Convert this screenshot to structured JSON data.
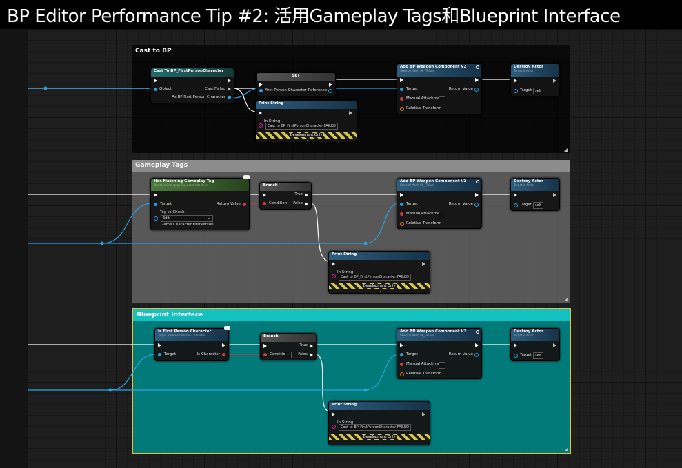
{
  "title": "BP Editor Performance Tip #2: 活用Gameplay Tags和Blueprint Interface",
  "colors": {
    "wire_blue": "#29a3e0",
    "wire_exec": "#ffffff",
    "comment_cyan": "#13c1c1",
    "comment_selected_border": "#e6c038"
  },
  "comments": [
    {
      "title": "Cast to BP"
    },
    {
      "title": "Gameplay Tags"
    },
    {
      "title": "Blueprint Interface"
    }
  ],
  "cast_section": {
    "cast_node": {
      "title": "Cast To BP_FirstPersonCharacter",
      "object": "Object",
      "cast_failed": "Cast Failed",
      "as": "As BP First Person Character"
    },
    "set_node": {
      "title": "SET",
      "pin": "First Person Character Reference"
    },
    "print_node": {
      "title": "Print String",
      "in_string": "In String",
      "value": "Cast to BP_FirstPersonCharacter FAILED",
      "dev": "Development Only"
    },
    "add_node": {
      "title": "Add BP Weapon Component V2",
      "subtitle": "Skeletal Mesh SK_FPGun",
      "target": "Target",
      "return_value": "Return Value",
      "manual": "Manual Attachment",
      "relative": "Relative Transform"
    },
    "destroy_node": {
      "title": "Destroy Actor",
      "subtitle": "Target is Actor",
      "target": "Target",
      "self": "self"
    }
  },
  "tags_section": {
    "has_tag_node": {
      "title": "Has Matching Gameplay Tag",
      "subtitle": "Target is Gameplay Tag Asset Interface",
      "target": "Target",
      "return_value": "Return Value",
      "tag_to_check": "Tag to Check",
      "edit": "Edit",
      "tag": "Game.Character.FirstPerson"
    },
    "branch_node": {
      "title": "Branch",
      "true": "True",
      "condition": "Condition",
      "false": "False"
    },
    "print_node": {
      "title": "Print String",
      "in_string": "In String",
      "value": "Cast to BP_FirstPersonCharacter FAILED",
      "dev": "Development Only"
    },
    "add_node": {
      "title": "Add BP Weapon Component V2",
      "subtitle": "Skeletal Mesh SK_FPGun",
      "target": "Target",
      "return_value": "Return Value",
      "manual": "Manual Attachment",
      "relative": "Relative Transform"
    },
    "destroy_node": {
      "title": "Destroy Actor",
      "subtitle": "Target is Actor",
      "target": "Target",
      "self": "self"
    }
  },
  "interface_section": {
    "is_fp_node": {
      "title": "Is First Person Character",
      "subtitle": "Target is BP First Person Character",
      "target": "Target",
      "is_character": "Is Character"
    },
    "branch_node": {
      "title": "Branch",
      "true": "True",
      "condition": "Condition",
      "false": "False"
    },
    "print_node": {
      "title": "Print String",
      "in_string": "In String",
      "value": "Cast to BP_FirstPersonCharacter FAILED",
      "dev": "Development Only"
    },
    "add_node": {
      "title": "Add BP Weapon Component V2",
      "subtitle": "Skeletal Mesh SK_FPGun",
      "target": "Target",
      "return_value": "Return Value",
      "manual": "Manual Attachment",
      "relative": "Relative Transform"
    },
    "destroy_node": {
      "title": "Destroy Actor",
      "subtitle": "Target is Actor",
      "target": "Target",
      "self": "self"
    }
  }
}
